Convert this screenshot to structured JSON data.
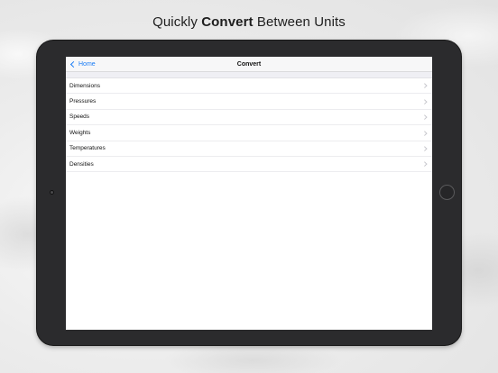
{
  "headline": {
    "prefix": "Quickly ",
    "emphasis": "Convert",
    "suffix": " Between Units"
  },
  "navbar": {
    "back_label": "Home",
    "back_icon": "chevron-left-icon",
    "title": "Convert"
  },
  "list": {
    "items": [
      {
        "label": "Dimensions"
      },
      {
        "label": "Pressures"
      },
      {
        "label": "Speeds"
      },
      {
        "label": "Weights"
      },
      {
        "label": "Temperatures"
      },
      {
        "label": "Densities"
      }
    ]
  },
  "colors": {
    "accent": "#1a7cf5",
    "device_frame": "#2b2b2d",
    "separator": "#ececef"
  }
}
